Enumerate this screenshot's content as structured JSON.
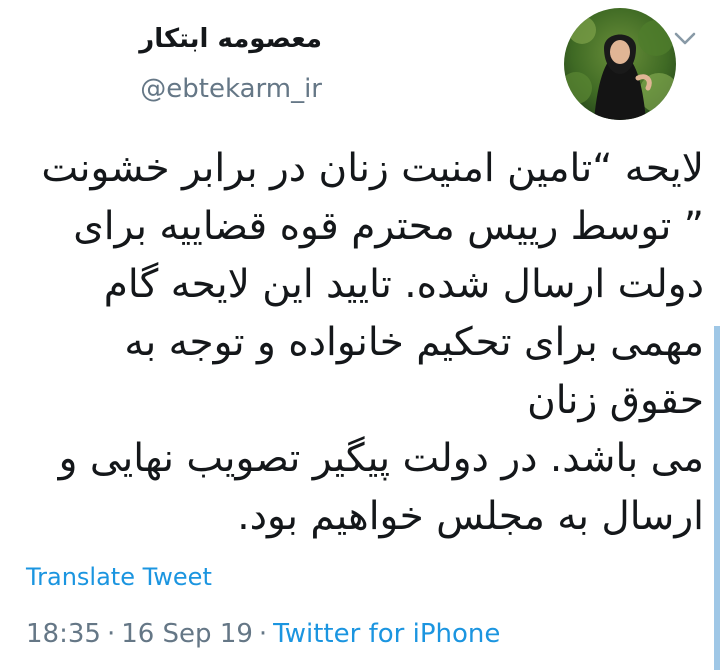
{
  "tweet": {
    "display_name": "معصومه ابتکار",
    "handle": "@ebtekarm_ir",
    "body": "لایحه “تامین امنیت  زنان در برابر  خشونت\n” توسط رییس محترم قوه قضاییه برای\nدولت ارسال شده. تایید این لایحه گام\nمهمی برای تحکیم خانواده و توجه به\nحقوق زنان\nمی باشد. در دولت پیگیر تصویب نهایی و\nارسال به مجلس خواهیم بود.",
    "translate_label": "Translate Tweet",
    "time": "18:35",
    "date": "16 Sep 19",
    "separator": "·",
    "source": "Twitter for iPhone"
  },
  "icons": {
    "chevron": "chevron-down-icon",
    "avatar": "avatar"
  },
  "colors": {
    "text": "#14171a",
    "secondary": "#657786",
    "link": "#1b95e0",
    "background": "#ffffff"
  }
}
